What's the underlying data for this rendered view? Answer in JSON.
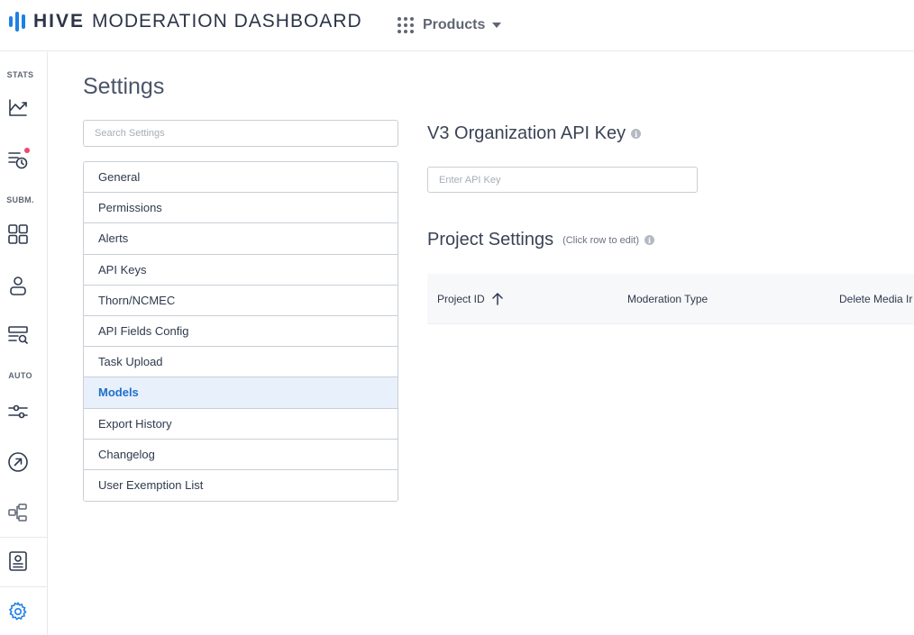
{
  "header": {
    "brand": "HIVE",
    "title": "MODERATION DASHBOARD",
    "products_label": "Products"
  },
  "rail": {
    "sections": {
      "stats": "STATS",
      "subm": "SUBM.",
      "auto": "AUTO"
    },
    "icons": [
      "chart-trend-icon",
      "queue-clock-icon",
      "grid-icon",
      "user-icon",
      "search-list-icon",
      "sliders-icon",
      "arrow-circle-icon",
      "flow-icon",
      "badge-document-icon",
      "gear-icon"
    ],
    "accent_color": "#1e80e6",
    "notification_color": "#f0476a"
  },
  "page": {
    "title": "Settings",
    "search_placeholder": "Search Settings"
  },
  "menu": {
    "items": [
      {
        "label": "General"
      },
      {
        "label": "Permissions"
      },
      {
        "label": "Alerts"
      },
      {
        "label": "API Keys"
      },
      {
        "label": "Thorn/NCMEC"
      },
      {
        "label": "API Fields Config"
      },
      {
        "label": "Task Upload"
      },
      {
        "label": "Models",
        "active": true
      },
      {
        "label": "Export History"
      },
      {
        "label": "Changelog"
      },
      {
        "label": "User Exemption List"
      }
    ],
    "active_color": "#1e6fc9",
    "active_bg": "#e8f0fb"
  },
  "api_key": {
    "title": "V3 Organization API Key",
    "placeholder": "Enter API Key"
  },
  "project_settings": {
    "title": "Project Settings",
    "hint": "(Click row to edit)",
    "columns": [
      "Project ID",
      "Moderation Type",
      "Delete Media Ir"
    ]
  }
}
